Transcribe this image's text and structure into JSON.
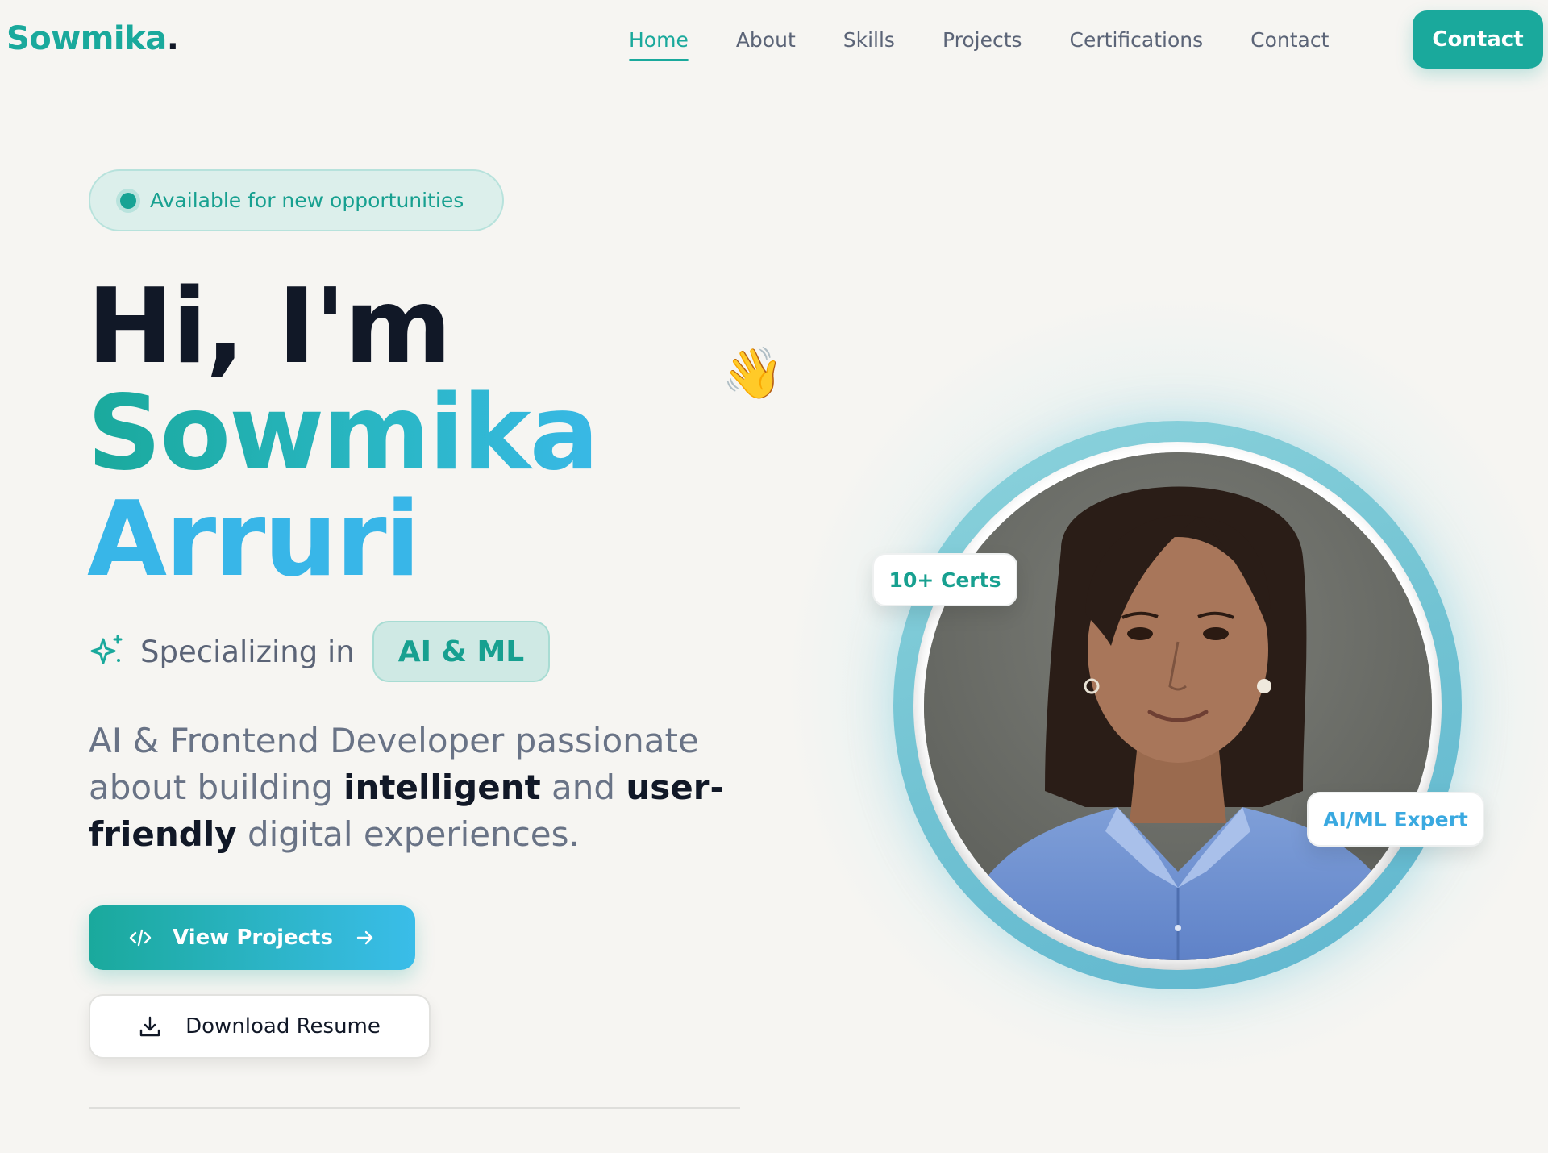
{
  "header": {
    "logo_text": "Sowmika",
    "logo_dot": ".",
    "nav": [
      {
        "label": "Home",
        "active": true
      },
      {
        "label": "About",
        "active": false
      },
      {
        "label": "Skills",
        "active": false
      },
      {
        "label": "Projects",
        "active": false
      },
      {
        "label": "Certifications",
        "active": false
      },
      {
        "label": "Contact",
        "active": false
      }
    ],
    "cta_label": "Contact"
  },
  "hero": {
    "status_badge": "Available for new opportunities",
    "greeting": "Hi, I'm",
    "first_name": "Sowmika",
    "last_name": "Arruri",
    "wave_emoji": "👋",
    "specializing_label": "Specializing in",
    "specialty": "AI & ML",
    "description": {
      "part1": "AI & Frontend Developer passionate about building ",
      "bold1": "intelligent",
      "part2": " and ",
      "bold2": "user-friendly",
      "part3": " digital experiences."
    },
    "primary_button": "View Projects",
    "secondary_button": "Download Resume"
  },
  "portrait": {
    "badge_certs": "10+ Certs",
    "badge_expert": "AI/ML Expert"
  },
  "colors": {
    "accent_teal": "#1aa99c",
    "accent_blue": "#38b6e8",
    "background": "#f6f5f2",
    "text_dark": "#111827",
    "text_muted": "#5b6477"
  },
  "icons": {
    "sparkle": "sparkles-icon",
    "code": "code-icon",
    "arrow": "arrow-right-icon",
    "download": "download-icon",
    "wave": "waving-hand-icon"
  }
}
